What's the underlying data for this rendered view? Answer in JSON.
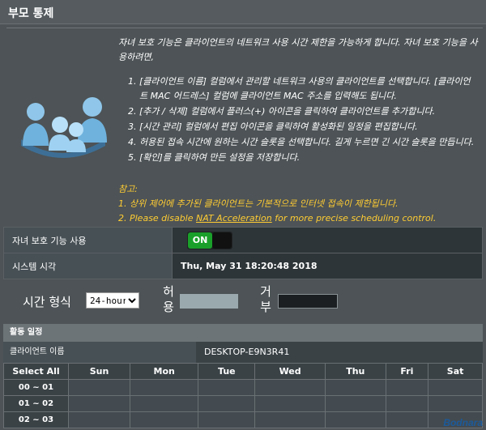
{
  "header": {
    "title": "부모 통제"
  },
  "description": {
    "intro": "자녀 보호 기능은 클라이언트의 네트워크 사용 시간 제한을 가능하게 합니다. 자녀 보호 기능을 사용하려면,",
    "steps": [
      "[클라이언트 이름] 컬럼에서 관리할 네트워크 사용의 클라이언트를 선택합니다. [클라이언트 MAC 어드레스] 컬럼에 클라이언트 MAC 주소를 입력해도 됩니다.",
      "[추가 / 삭제] 컬럼에서 플러스(+) 아이콘을 클릭하여 클라이언트를 추가합니다.",
      "[시간 관리] 컬럼에서 편집 아이콘을 클릭하여 활성화된 일정을 편집합니다.",
      "허용된 접속 시간에 원하는 시간 슬롯을 선택합니다. 길게 누르면 긴 시간 슬롯을 만듭니다.",
      "[확인]를 클릭하여 만든 설정을 저장합니다."
    ]
  },
  "notes": {
    "heading": "참고:",
    "item1": "1.  상위 제어에 추가된 클라이언트는 기본적으로 인터넷 접속이 제한됩니다.",
    "item2_prefix": "2.  Please disable ",
    "item2_link": "NAT Acceleration",
    "item2_suffix": " for more precise scheduling control."
  },
  "settings": {
    "enable_label": "자녀 보호 기능 사용",
    "enable_state": "ON",
    "system_time_label": "시스템 시각",
    "system_time_value": "Thu, May 31 18:20:48 2018"
  },
  "time_format": {
    "label": "시간 형식",
    "selected": "24-hour",
    "allow_label_1": "허",
    "allow_label_2": "용",
    "deny_label_1": "거",
    "deny_label_2": "부"
  },
  "schedule": {
    "heading": "활동 일정",
    "client_label": "클라이언트 이름",
    "client_value": "DESKTOP-E9N3R41",
    "select_all": "Select All",
    "days": [
      "Sun",
      "Mon",
      "Tue",
      "Wed",
      "Thu",
      "Fri",
      "Sat"
    ],
    "hours": [
      "00 ~ 01",
      "01 ~ 02",
      "02 ~ 03"
    ]
  },
  "watermark": "Bodnara",
  "colors": {
    "background": "#4d5356",
    "note_text": "#ffcc33",
    "toggle_on": "#1aa02a",
    "allow_swatch": "#9aa9ae",
    "deny_swatch": "#1b1f21"
  }
}
